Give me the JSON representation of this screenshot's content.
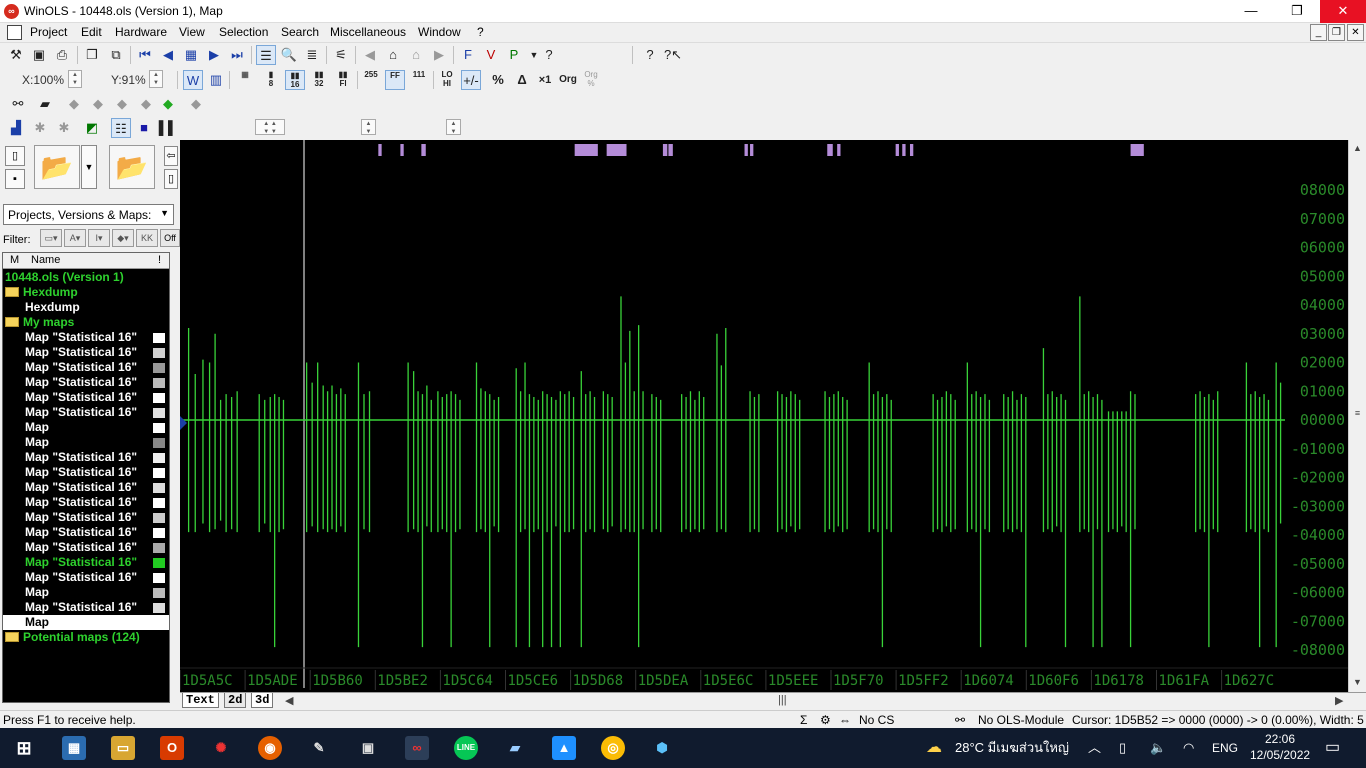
{
  "titlebar": {
    "title": "WinOLS - 10448.ols (Version 1), Map",
    "minimize": "—",
    "maximize": "❐",
    "close": "✕"
  },
  "menu": [
    "Project",
    "Edit",
    "Hardware",
    "View",
    "Selection",
    "Search",
    "Miscellaneous",
    "Window",
    "?"
  ],
  "toolbar": {
    "zoom_x": "X:100%",
    "zoom_y": "Y:91%"
  },
  "left": {
    "combo": "Projects, Versions & Maps:",
    "filter_label": "Filter:",
    "filter_off": "Off",
    "tree_header": {
      "col_m": "M",
      "col_name": "Name",
      "col_excl": "!"
    },
    "tree": [
      {
        "label": "10448.ols (Version 1)",
        "style": "green",
        "indent": 0,
        "folder": false,
        "sw": ""
      },
      {
        "label": "Hexdump",
        "style": "green",
        "indent": 0,
        "folder": true,
        "sw": ""
      },
      {
        "label": "Hexdump",
        "style": "white",
        "indent": 20,
        "folder": false,
        "sw": ""
      },
      {
        "label": "My maps",
        "style": "green",
        "indent": 0,
        "folder": true,
        "sw": ""
      },
      {
        "label": "Map \"Statistical 16\"",
        "style": "white",
        "indent": 20,
        "folder": false,
        "sw": "#ffffff"
      },
      {
        "label": "Map \"Statistical 16\"",
        "style": "white",
        "indent": 20,
        "folder": false,
        "sw": "#d0d0d0"
      },
      {
        "label": "Map \"Statistical 16\"",
        "style": "white",
        "indent": 20,
        "folder": false,
        "sw": "#999999"
      },
      {
        "label": "Map \"Statistical 16\"",
        "style": "white",
        "indent": 20,
        "folder": false,
        "sw": "#bbbbbb"
      },
      {
        "label": "Map \"Statistical 16\"",
        "style": "white",
        "indent": 20,
        "folder": false,
        "sw": "#ffffff"
      },
      {
        "label": "Map \"Statistical 16\"",
        "style": "white",
        "indent": 20,
        "folder": false,
        "sw": "#e0e0e0"
      },
      {
        "label": "Map",
        "style": "white",
        "indent": 20,
        "folder": false,
        "sw": "#ffffff"
      },
      {
        "label": "Map",
        "style": "white",
        "indent": 20,
        "folder": false,
        "sw": "#888888"
      },
      {
        "label": "Map \"Statistical 16\"",
        "style": "white",
        "indent": 20,
        "folder": false,
        "sw": "#eeeeee"
      },
      {
        "label": "Map \"Statistical 16\"",
        "style": "white",
        "indent": 20,
        "folder": false,
        "sw": "#ffffff"
      },
      {
        "label": "Map \"Statistical 16\"",
        "style": "white",
        "indent": 20,
        "folder": false,
        "sw": "#dddddd"
      },
      {
        "label": "Map \"Statistical 16\"",
        "style": "white",
        "indent": 20,
        "folder": false,
        "sw": "#ffffff"
      },
      {
        "label": "Map \"Statistical 16\"",
        "style": "white",
        "indent": 20,
        "folder": false,
        "sw": "#cccccc"
      },
      {
        "label": "Map \"Statistical 16\"",
        "style": "white",
        "indent": 20,
        "folder": false,
        "sw": "#ffffff"
      },
      {
        "label": "Map \"Statistical 16\"",
        "style": "white",
        "indent": 20,
        "folder": false,
        "sw": "#aaaaaa"
      },
      {
        "label": "Map \"Statistical 16\"",
        "style": "green",
        "indent": 20,
        "folder": false,
        "sw": "#22cc22"
      },
      {
        "label": "Map \"Statistical 16\"",
        "style": "white",
        "indent": 20,
        "folder": false,
        "sw": "#ffffff"
      },
      {
        "label": "Map",
        "style": "white",
        "indent": 20,
        "folder": false,
        "sw": "#bbbbbb"
      },
      {
        "label": "Map \"Statistical 16\"",
        "style": "white",
        "indent": 20,
        "folder": false,
        "sw": "#dddddd"
      },
      {
        "label": "Map",
        "style": "sel",
        "indent": 20,
        "folder": false,
        "sw": ""
      },
      {
        "label": "Potential maps (124)",
        "style": "green",
        "indent": 0,
        "folder": true,
        "sw": ""
      }
    ]
  },
  "chart_data": {
    "type": "line",
    "trace_color": "#39d339",
    "background": "#000000",
    "y_ticks": [
      "08000",
      "07000",
      "06000",
      "05000",
      "04000",
      "03000",
      "02000",
      "01000",
      "00000",
      "-01000",
      "-02000",
      "-03000",
      "-04000",
      "-05000",
      "-06000",
      "-07000",
      "-08000"
    ],
    "ylim": [
      -8000,
      8000
    ],
    "x_ticks": [
      "1D5A5C",
      "1D5ADE",
      "1D5B60",
      "1D5BE2",
      "1D5C64",
      "1D5CE6",
      "1D5D68",
      "1D5DEA",
      "1D5E6C",
      "1D5EEE",
      "1D5F70",
      "1D5FF2",
      "1D6074",
      "1D60F6",
      "1D6178",
      "1D61FA",
      "1D627C"
    ],
    "baseline": 0,
    "spikes": [
      {
        "x": 0.6,
        "hi": 3200,
        "lo": -3900
      },
      {
        "x": 1.2,
        "hi": 1600,
        "lo": -3900
      },
      {
        "x": 1.9,
        "hi": 2100,
        "lo": -3600
      },
      {
        "x": 2.5,
        "hi": 2000,
        "lo": -3900
      },
      {
        "x": 3.0,
        "hi": 3000,
        "lo": -3800
      },
      {
        "x": 3.5,
        "hi": 700,
        "lo": -3500
      },
      {
        "x": 4.0,
        "hi": 900,
        "lo": -3900
      },
      {
        "x": 4.5,
        "hi": 800,
        "lo": -3800
      },
      {
        "x": 5.0,
        "hi": 1000,
        "lo": -3900
      },
      {
        "x": 7.0,
        "hi": 900,
        "lo": -3900
      },
      {
        "x": 7.5,
        "hi": 700,
        "lo": -3600
      },
      {
        "x": 8.0,
        "hi": 800,
        "lo": -3900
      },
      {
        "x": 8.4,
        "hi": 900,
        "lo": -7900
      },
      {
        "x": 8.8,
        "hi": 800,
        "lo": -3900
      },
      {
        "x": 9.2,
        "hi": 700,
        "lo": -3800
      },
      {
        "x": 11.3,
        "hi": 2000,
        "lo": -3900
      },
      {
        "x": 11.8,
        "hi": 1300,
        "lo": -3700
      },
      {
        "x": 12.3,
        "hi": 2000,
        "lo": -3900
      },
      {
        "x": 12.8,
        "hi": 1200,
        "lo": -3800
      },
      {
        "x": 13.2,
        "hi": 1000,
        "lo": -3900
      },
      {
        "x": 13.6,
        "hi": 1200,
        "lo": -3800
      },
      {
        "x": 14.0,
        "hi": 900,
        "lo": -3900
      },
      {
        "x": 14.4,
        "hi": 1100,
        "lo": -3700
      },
      {
        "x": 14.8,
        "hi": 900,
        "lo": -3900
      },
      {
        "x": 16.0,
        "hi": 2000,
        "lo": -7900
      },
      {
        "x": 16.5,
        "hi": 900,
        "lo": -3800
      },
      {
        "x": 17.0,
        "hi": 1000,
        "lo": -3900
      },
      {
        "x": 20.5,
        "hi": 2000,
        "lo": -3900
      },
      {
        "x": 21.0,
        "hi": 1700,
        "lo": -3800
      },
      {
        "x": 21.4,
        "hi": 1000,
        "lo": -3900
      },
      {
        "x": 21.8,
        "hi": 900,
        "lo": -7900
      },
      {
        "x": 22.2,
        "hi": 1200,
        "lo": -3700
      },
      {
        "x": 22.6,
        "hi": 700,
        "lo": -3900
      },
      {
        "x": 23.2,
        "hi": 1000,
        "lo": -3900
      },
      {
        "x": 23.6,
        "hi": 800,
        "lo": -3800
      },
      {
        "x": 24.0,
        "hi": 900,
        "lo": -3900
      },
      {
        "x": 24.4,
        "hi": 1000,
        "lo": -7900
      },
      {
        "x": 24.8,
        "hi": 900,
        "lo": -3900
      },
      {
        "x": 25.2,
        "hi": 700,
        "lo": -3800
      },
      {
        "x": 26.7,
        "hi": 2000,
        "lo": -3900
      },
      {
        "x": 27.1,
        "hi": 1100,
        "lo": -3800
      },
      {
        "x": 27.5,
        "hi": 1000,
        "lo": -3900
      },
      {
        "x": 27.9,
        "hi": 900,
        "lo": -7900
      },
      {
        "x": 28.3,
        "hi": 700,
        "lo": -3700
      },
      {
        "x": 28.7,
        "hi": 800,
        "lo": -3900
      },
      {
        "x": 30.3,
        "hi": 1800,
        "lo": -7900
      },
      {
        "x": 30.7,
        "hi": 1000,
        "lo": -3900
      },
      {
        "x": 31.1,
        "hi": 2000,
        "lo": -3800
      },
      {
        "x": 31.5,
        "hi": 900,
        "lo": -7900
      },
      {
        "x": 31.9,
        "hi": 800,
        "lo": -3900
      },
      {
        "x": 32.3,
        "hi": 700,
        "lo": -3800
      },
      {
        "x": 32.7,
        "hi": 1000,
        "lo": -7900
      },
      {
        "x": 33.1,
        "hi": 900,
        "lo": -3900
      },
      {
        "x": 33.5,
        "hi": 800,
        "lo": -7900
      },
      {
        "x": 33.9,
        "hi": 700,
        "lo": -3700
      },
      {
        "x": 34.3,
        "hi": 1000,
        "lo": -7900
      },
      {
        "x": 34.7,
        "hi": 900,
        "lo": -3900
      },
      {
        "x": 35.1,
        "hi": 1000,
        "lo": -3900
      },
      {
        "x": 35.5,
        "hi": 800,
        "lo": -3800
      },
      {
        "x": 36.2,
        "hi": 1700,
        "lo": -7900
      },
      {
        "x": 36.6,
        "hi": 900,
        "lo": -3900
      },
      {
        "x": 37.0,
        "hi": 1000,
        "lo": -3800
      },
      {
        "x": 37.4,
        "hi": 800,
        "lo": -3900
      },
      {
        "x": 38.2,
        "hi": 1000,
        "lo": -3800
      },
      {
        "x": 38.6,
        "hi": 900,
        "lo": -3900
      },
      {
        "x": 39.0,
        "hi": 800,
        "lo": -3700
      },
      {
        "x": 39.8,
        "hi": 4300,
        "lo": -3900
      },
      {
        "x": 40.2,
        "hi": 2000,
        "lo": -3800
      },
      {
        "x": 40.6,
        "hi": 3100,
        "lo": -3900
      },
      {
        "x": 41.0,
        "hi": 1000,
        "lo": -3900
      },
      {
        "x": 41.4,
        "hi": 3300,
        "lo": -7900
      },
      {
        "x": 41.8,
        "hi": 1000,
        "lo": -3800
      },
      {
        "x": 42.6,
        "hi": 900,
        "lo": -3900
      },
      {
        "x": 43.0,
        "hi": 800,
        "lo": -3800
      },
      {
        "x": 43.4,
        "hi": 700,
        "lo": -3900
      },
      {
        "x": 45.3,
        "hi": 900,
        "lo": -3900
      },
      {
        "x": 45.7,
        "hi": 800,
        "lo": -3800
      },
      {
        "x": 46.1,
        "hi": 1000,
        "lo": -3900
      },
      {
        "x": 46.5,
        "hi": 700,
        "lo": -3800
      },
      {
        "x": 46.9,
        "hi": 1000,
        "lo": -3900
      },
      {
        "x": 47.3,
        "hi": 800,
        "lo": -3800
      },
      {
        "x": 48.5,
        "hi": 3000,
        "lo": -3900
      },
      {
        "x": 48.9,
        "hi": 1900,
        "lo": -3800
      },
      {
        "x": 49.3,
        "hi": 3200,
        "lo": -3900
      },
      {
        "x": 51.5,
        "hi": 1000,
        "lo": -3900
      },
      {
        "x": 51.9,
        "hi": 800,
        "lo": -3800
      },
      {
        "x": 52.3,
        "hi": 900,
        "lo": -3900
      },
      {
        "x": 54.0,
        "hi": 1000,
        "lo": -3900
      },
      {
        "x": 54.4,
        "hi": 900,
        "lo": -3800
      },
      {
        "x": 54.8,
        "hi": 800,
        "lo": -3900
      },
      {
        "x": 55.2,
        "hi": 1000,
        "lo": -3700
      },
      {
        "x": 55.6,
        "hi": 900,
        "lo": -3900
      },
      {
        "x": 56.0,
        "hi": 700,
        "lo": -3800
      },
      {
        "x": 58.3,
        "hi": 1000,
        "lo": -3900
      },
      {
        "x": 58.7,
        "hi": 800,
        "lo": -3800
      },
      {
        "x": 59.1,
        "hi": 900,
        "lo": -3900
      },
      {
        "x": 59.5,
        "hi": 1000,
        "lo": -3700
      },
      {
        "x": 59.9,
        "hi": 800,
        "lo": -3900
      },
      {
        "x": 60.3,
        "hi": 700,
        "lo": -3800
      },
      {
        "x": 62.3,
        "hi": 2000,
        "lo": -3900
      },
      {
        "x": 62.7,
        "hi": 900,
        "lo": -3800
      },
      {
        "x": 63.1,
        "hi": 1000,
        "lo": -3900
      },
      {
        "x": 63.5,
        "hi": 800,
        "lo": -7900
      },
      {
        "x": 63.9,
        "hi": 900,
        "lo": -3800
      },
      {
        "x": 64.3,
        "hi": 700,
        "lo": -3900
      },
      {
        "x": 68.1,
        "hi": 900,
        "lo": -3900
      },
      {
        "x": 68.5,
        "hi": 700,
        "lo": -3800
      },
      {
        "x": 68.9,
        "hi": 800,
        "lo": -3900
      },
      {
        "x": 69.3,
        "hi": 1000,
        "lo": -3700
      },
      {
        "x": 69.7,
        "hi": 900,
        "lo": -3900
      },
      {
        "x": 70.1,
        "hi": 700,
        "lo": -3800
      },
      {
        "x": 71.2,
        "hi": 2000,
        "lo": -3900
      },
      {
        "x": 71.6,
        "hi": 900,
        "lo": -3800
      },
      {
        "x": 72.0,
        "hi": 1000,
        "lo": -3900
      },
      {
        "x": 72.4,
        "hi": 800,
        "lo": -7900
      },
      {
        "x": 72.8,
        "hi": 900,
        "lo": -3800
      },
      {
        "x": 73.2,
        "hi": 700,
        "lo": -3900
      },
      {
        "x": 74.5,
        "hi": 900,
        "lo": -3900
      },
      {
        "x": 74.9,
        "hi": 800,
        "lo": -3800
      },
      {
        "x": 75.3,
        "hi": 1000,
        "lo": -3900
      },
      {
        "x": 75.7,
        "hi": 700,
        "lo": -3800
      },
      {
        "x": 76.1,
        "hi": 900,
        "lo": -3900
      },
      {
        "x": 76.5,
        "hi": 800,
        "lo": -7900
      },
      {
        "x": 78.1,
        "hi": 2500,
        "lo": -3900
      },
      {
        "x": 78.5,
        "hi": 900,
        "lo": -3800
      },
      {
        "x": 78.9,
        "hi": 1000,
        "lo": -3900
      },
      {
        "x": 79.3,
        "hi": 800,
        "lo": -3700
      },
      {
        "x": 79.7,
        "hi": 900,
        "lo": -3900
      },
      {
        "x": 80.1,
        "hi": 700,
        "lo": -7900
      },
      {
        "x": 81.4,
        "hi": 4300,
        "lo": -3900
      },
      {
        "x": 81.8,
        "hi": 900,
        "lo": -3800
      },
      {
        "x": 82.2,
        "hi": 1000,
        "lo": -3900
      },
      {
        "x": 82.6,
        "hi": 800,
        "lo": -7900
      },
      {
        "x": 83.0,
        "hi": 900,
        "lo": -3800
      },
      {
        "x": 83.4,
        "hi": 700,
        "lo": -7900
      },
      {
        "x": 84.0,
        "hi": 300,
        "lo": -3900
      },
      {
        "x": 84.4,
        "hi": 300,
        "lo": -3800
      },
      {
        "x": 84.8,
        "hi": 300,
        "lo": -3900
      },
      {
        "x": 85.2,
        "hi": 300,
        "lo": -3700
      },
      {
        "x": 85.6,
        "hi": 300,
        "lo": -3900
      },
      {
        "x": 86.0,
        "hi": 1000,
        "lo": -7900
      },
      {
        "x": 86.4,
        "hi": 900,
        "lo": -3800
      },
      {
        "x": 91.9,
        "hi": 900,
        "lo": -3900
      },
      {
        "x": 92.3,
        "hi": 1000,
        "lo": -3800
      },
      {
        "x": 92.7,
        "hi": 800,
        "lo": -3900
      },
      {
        "x": 93.1,
        "hi": 900,
        "lo": -7900
      },
      {
        "x": 93.5,
        "hi": 700,
        "lo": -3800
      },
      {
        "x": 93.9,
        "hi": 1000,
        "lo": -3900
      },
      {
        "x": 96.5,
        "hi": 2000,
        "lo": -3900
      },
      {
        "x": 96.9,
        "hi": 900,
        "lo": -3800
      },
      {
        "x": 97.3,
        "hi": 1000,
        "lo": -3900
      },
      {
        "x": 97.7,
        "hi": 800,
        "lo": -7900
      },
      {
        "x": 98.1,
        "hi": 900,
        "lo": -3800
      },
      {
        "x": 98.5,
        "hi": 700,
        "lo": -3900
      },
      {
        "x": 99.2,
        "hi": 2000,
        "lo": -7900
      },
      {
        "x": 99.6,
        "hi": 1300,
        "lo": -3600
      }
    ],
    "marker_bars": [
      {
        "x": 17.8,
        "w": 0.3
      },
      {
        "x": 19.8,
        "w": 0.3
      },
      {
        "x": 21.7,
        "w": 0.4
      },
      {
        "x": 35.6,
        "w": 2.1
      },
      {
        "x": 38.5,
        "w": 1.8
      },
      {
        "x": 43.6,
        "w": 0.4
      },
      {
        "x": 44.1,
        "w": 0.4
      },
      {
        "x": 51.0,
        "w": 0.3
      },
      {
        "x": 51.5,
        "w": 0.3
      },
      {
        "x": 58.5,
        "w": 0.5
      },
      {
        "x": 59.4,
        "w": 0.3
      },
      {
        "x": 64.7,
        "w": 0.3
      },
      {
        "x": 65.3,
        "w": 0.3
      },
      {
        "x": 66.0,
        "w": 0.3
      },
      {
        "x": 86.0,
        "w": 1.2
      }
    ]
  },
  "tabs": {
    "text": "Text",
    "d2": "2d",
    "d3": "3d"
  },
  "status": {
    "help": "Press F1 to receive help.",
    "cs": "No CS",
    "ols": "No OLS-Module",
    "cursor": "Cursor: 1D5B52 => 0000 (0000) -> 0 (0.00%), Width: 5"
  },
  "taskbar": {
    "weather": "28°C  มีเมฆส่วนใหญ่",
    "lang": "ENG",
    "time": "22:06",
    "date": "12/05/2022"
  }
}
